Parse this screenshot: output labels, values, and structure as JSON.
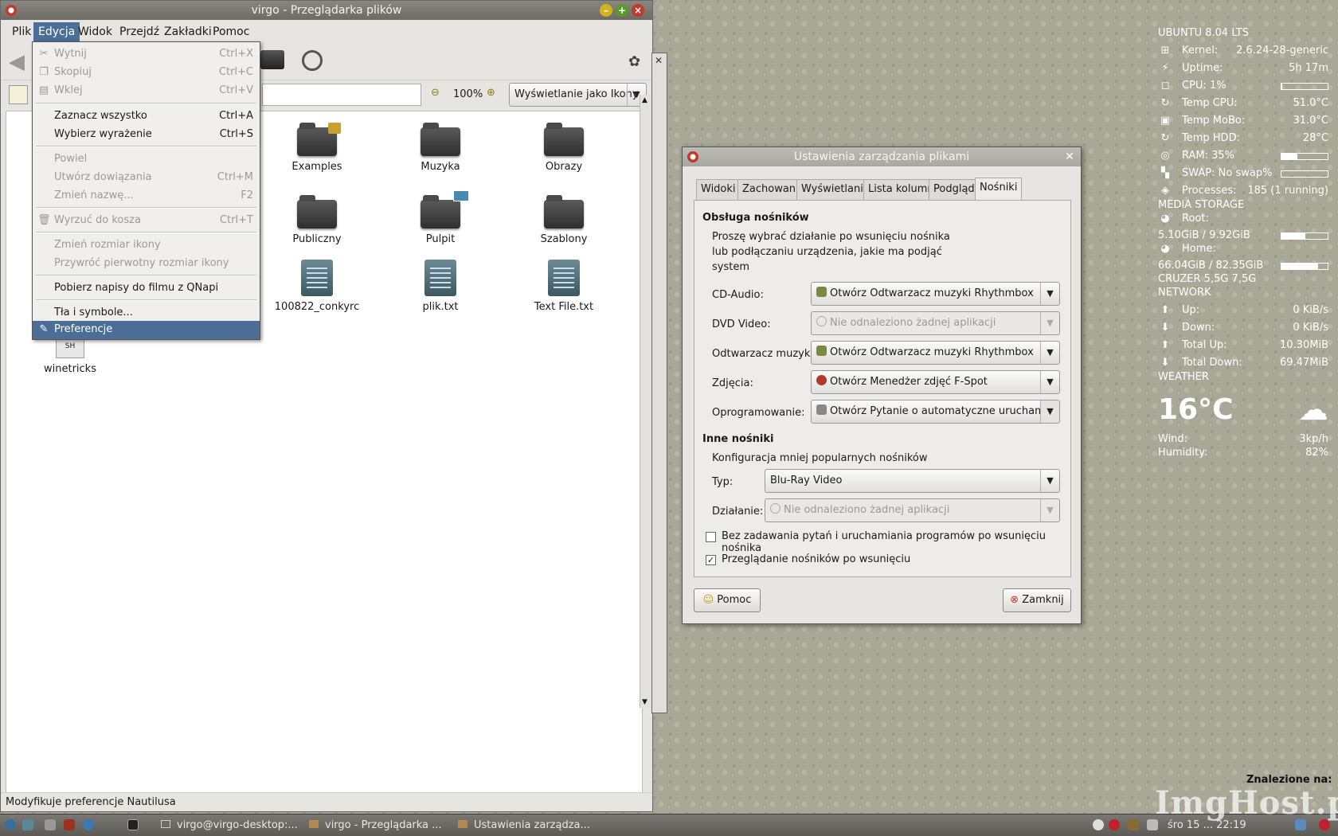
{
  "nautilus": {
    "title": "virgo - Przeglądarka plików",
    "menus": [
      "Plik",
      "Edycja",
      "Widok",
      "Przejdź",
      "Zakładki",
      "Pomoc"
    ],
    "zoom": "100%",
    "view_mode": "Wyświetlanie jako Ikony",
    "files": [
      {
        "name": "Examples",
        "type": "folder"
      },
      {
        "name": "Muzyka",
        "type": "folder"
      },
      {
        "name": "Obrazy",
        "type": "folder"
      },
      {
        "name": "Publiczny",
        "type": "folder"
      },
      {
        "name": "Pulpit",
        "type": "folder"
      },
      {
        "name": "Szablony",
        "type": "folder"
      },
      {
        "name": "100822_conkyrc",
        "type": "text"
      },
      {
        "name": "plik.txt",
        "type": "text"
      },
      {
        "name": "Text File.txt",
        "type": "text"
      },
      {
        "name": "winetricks",
        "type": "script"
      }
    ],
    "status": "Modyfikuje preferencje Nautilusa"
  },
  "edit_menu": [
    {
      "label": "Wytnij",
      "accel": "Ctrl+X",
      "disabled": true
    },
    {
      "label": "Skopiuj",
      "accel": "Ctrl+C",
      "disabled": true
    },
    {
      "label": "Wklej",
      "accel": "Ctrl+V",
      "disabled": true
    },
    {
      "label": "Zaznacz wszystko",
      "accel": "Ctrl+A",
      "disabled": false
    },
    {
      "label": "Wybierz wyrażenie",
      "accel": "Ctrl+S",
      "disabled": false
    },
    {
      "label": "Powiel",
      "accel": "",
      "disabled": true
    },
    {
      "label": "Utwórz dowiązania",
      "accel": "Ctrl+M",
      "disabled": true
    },
    {
      "label": "Zmień nazwę...",
      "accel": "F2",
      "disabled": true
    },
    {
      "label": "Wyrzuć do kosza",
      "accel": "Ctrl+T",
      "disabled": true
    },
    {
      "label": "Zmień rozmiar ikony",
      "accel": "",
      "disabled": true
    },
    {
      "label": "Przywróć pierwotny rozmiar ikony",
      "accel": "",
      "disabled": true
    },
    {
      "label": "Pobierz napisy do filmu z QNapi",
      "accel": "",
      "disabled": false
    },
    {
      "label": "Tła i symbole...",
      "accel": "",
      "disabled": false
    },
    {
      "label": "Preferencje",
      "accel": "",
      "disabled": false,
      "selected": true
    }
  ],
  "prefs": {
    "title": "Ustawienia zarządzania plikami",
    "tabs": [
      "Widoki",
      "Zachowanie",
      "Wyświetlanie",
      "Lista kolumn",
      "Podgląd",
      "Nośniki"
    ],
    "active_tab": "Nośniki",
    "section1": "Obsługa nośników",
    "desc1": [
      "Proszę wybrać działanie po wsunięciu nośnika",
      "lub podłączaniu urządzenia, jakie ma podjąć",
      "system"
    ],
    "rows": [
      {
        "label": "CD-Audio:",
        "value": "Otwórz Odtwarzacz muzyki Rhythmbox",
        "disabled": false
      },
      {
        "label": "DVD Video:",
        "value": "Nie odnaleziono żadnej aplikacji",
        "disabled": true
      },
      {
        "label": "Odtwarzacz muzyki:",
        "value": "Otwórz Odtwarzacz muzyki Rhythmbox",
        "disabled": false
      },
      {
        "label": "Zdjęcia:",
        "value": "Otwórz Menedżer zdjęć F-Spot",
        "disabled": false
      },
      {
        "label": "Oprogramowanie:",
        "value": "Otwórz Pytanie o automatyczne uruchamianie",
        "disabled": false
      }
    ],
    "section2": "Inne nośniki",
    "desc2": "Konfiguracja mniej popularnych nośników",
    "type_label": "Typ:",
    "type_value": "Blu-Ray Video",
    "action_label": "Działanie:",
    "action_value": "Nie odnaleziono żadnej aplikacji",
    "check1": {
      "label": "Bez zadawania pytań i uruchamiania programów po wsunięciu nośnika",
      "checked": false
    },
    "check2": {
      "label": "Przeglądanie nośników po wsunięciu",
      "checked": true
    },
    "help_btn": "Pomoc",
    "close_btn": "Zamknij"
  },
  "conky": {
    "os": "UBUNTU 8.04 LTS",
    "rows": [
      {
        "label": "Kernel:",
        "value": "2.6.24-28-generic"
      },
      {
        "label": "Uptime:",
        "value": "5h 17m"
      },
      {
        "label": "CPU: 1%",
        "value": "",
        "bar": 0.01
      },
      {
        "label": "Temp CPU:",
        "value": "51.0°C"
      },
      {
        "label": "Temp MoBo:",
        "value": "31.0°C"
      },
      {
        "label": "Temp HDD:",
        "value": "28°C"
      },
      {
        "label": "RAM: 35%",
        "value": "",
        "bar": 0.35
      },
      {
        "label": "SWAP: No swap%",
        "value": "",
        "bar": 0
      },
      {
        "label": "Processes:",
        "value": "185 (1 running)"
      }
    ],
    "storage_title": "MEDIA STORAGE",
    "root_label": "Root:",
    "root_value": "5.10GiB / 9.92GiB",
    "root_bar": 0.51,
    "home_label": "Home:",
    "home_value": "66.04GiB / 82.35GiB",
    "home_bar": 0.8,
    "cruzer": "CRUZER 5,5G 7,5G",
    "network_title": "NETWORK",
    "net": [
      {
        "label": "Up:",
        "value": "0 KiB/s"
      },
      {
        "label": "Down:",
        "value": "0 KiB/s"
      },
      {
        "label": "Total Up:",
        "value": "10.30MiB"
      },
      {
        "label": "Total Down:",
        "value": "69.47MiB"
      }
    ],
    "weather_title": "WEATHER",
    "temp": "16°C",
    "wind_label": "Wind:",
    "wind": "3kp/h",
    "hum_label": "Humidity:",
    "hum": "82%"
  },
  "taskbar": {
    "tasks": [
      "virgo@virgo-desktop:...",
      "virgo - Przeglądarka ...",
      "Ustawienia zarządza..."
    ],
    "clock": "śro 15 ... 22:19"
  },
  "watermark": "ImgHost.pl",
  "watermark_note": "Znalezione na:"
}
